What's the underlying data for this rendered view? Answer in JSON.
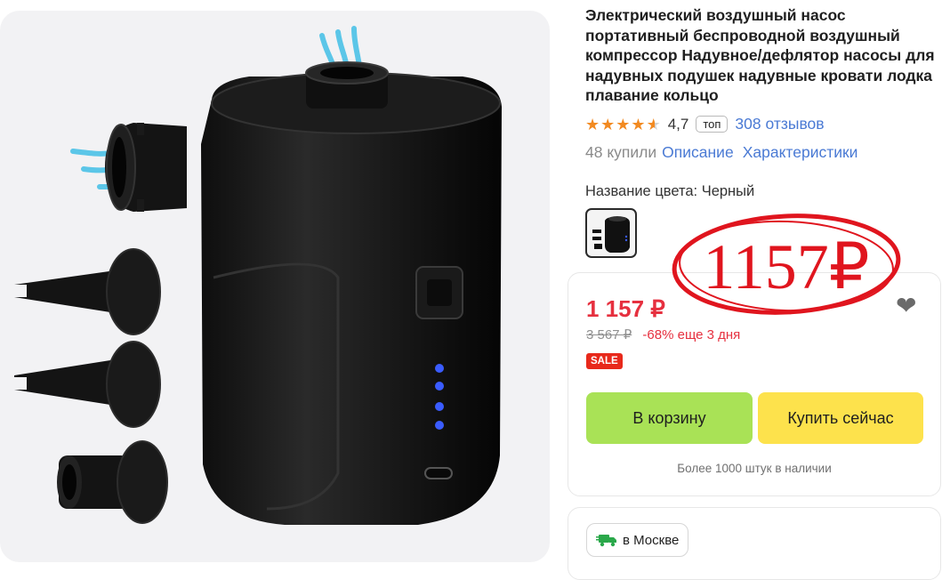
{
  "product": {
    "title": "Электрический воздушный насос портативный беспроводной воздушный компрессор Надувное/дефлятор насосы для надувных подушек надувные кровати лодка плавание кольцо",
    "rating": "4,7",
    "top_badge": "топ",
    "reviews": "308 отзывов",
    "bought": "48 купили",
    "description_link": "Описание",
    "specs_link": "Характеристики",
    "color_label": "Название цвета: Черный"
  },
  "stamp": {
    "text": "1157₽",
    "color": "#e0151e"
  },
  "buybox": {
    "price": "1 157 ₽",
    "old_price": "3 567 ₽",
    "discount": "-68% еще 3 дня",
    "sale_badge": "SALE",
    "cart_button": "В корзину",
    "buy_button": "Купить сейчас",
    "stock": "Более 1000 штук в наличии"
  },
  "delivery": {
    "city": "в Москве"
  },
  "colors": {
    "price_red": "#e6303f",
    "cart_green": "#a9e256",
    "buy_yellow": "#fde24c",
    "link_blue": "#4a7ad4",
    "star_orange": "#f28a21"
  },
  "icons": [
    "heart-icon",
    "delivery-truck-icon",
    "star-icon"
  ]
}
